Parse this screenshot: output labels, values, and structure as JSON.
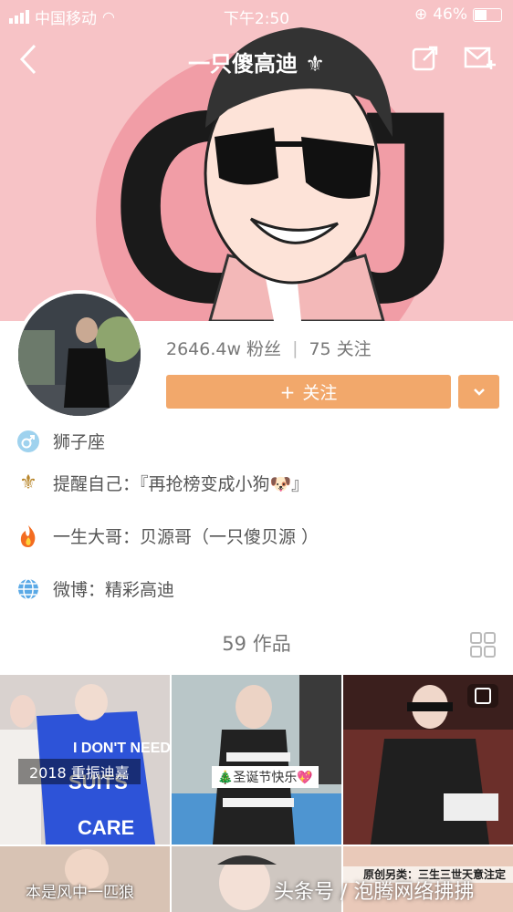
{
  "status_bar": {
    "carrier": "中国移动",
    "time": "下午2:50",
    "battery": "46%"
  },
  "nav": {
    "title": "一只傻高迪 ⚜"
  },
  "profile": {
    "followers": "2646.4w 粉丝",
    "following": "75 关注",
    "follow_button": "关注"
  },
  "bio": {
    "zodiac": "狮子座",
    "line1": "提醒自己：『再抢榜变成小狗🐶』",
    "line2": "一生大哥：贝源哥（一只傻贝源 ）",
    "line3": "微博：精彩高迪"
  },
  "works": {
    "count_label": "59 作品"
  },
  "videos": [
    {
      "caption": "2018 重振迪嘉"
    },
    {
      "caption": "🎄圣诞节快乐💖"
    },
    {
      "caption": ""
    },
    {
      "caption": "本是风中一匹狼"
    },
    {
      "caption": ""
    },
    {
      "caption": "原创另类：三生三世天意注定"
    }
  ],
  "watermark": "头条号 / 泡腾网络拂拂",
  "colors": {
    "accent": "#f2a86b",
    "banner": "#f7c3c6"
  }
}
